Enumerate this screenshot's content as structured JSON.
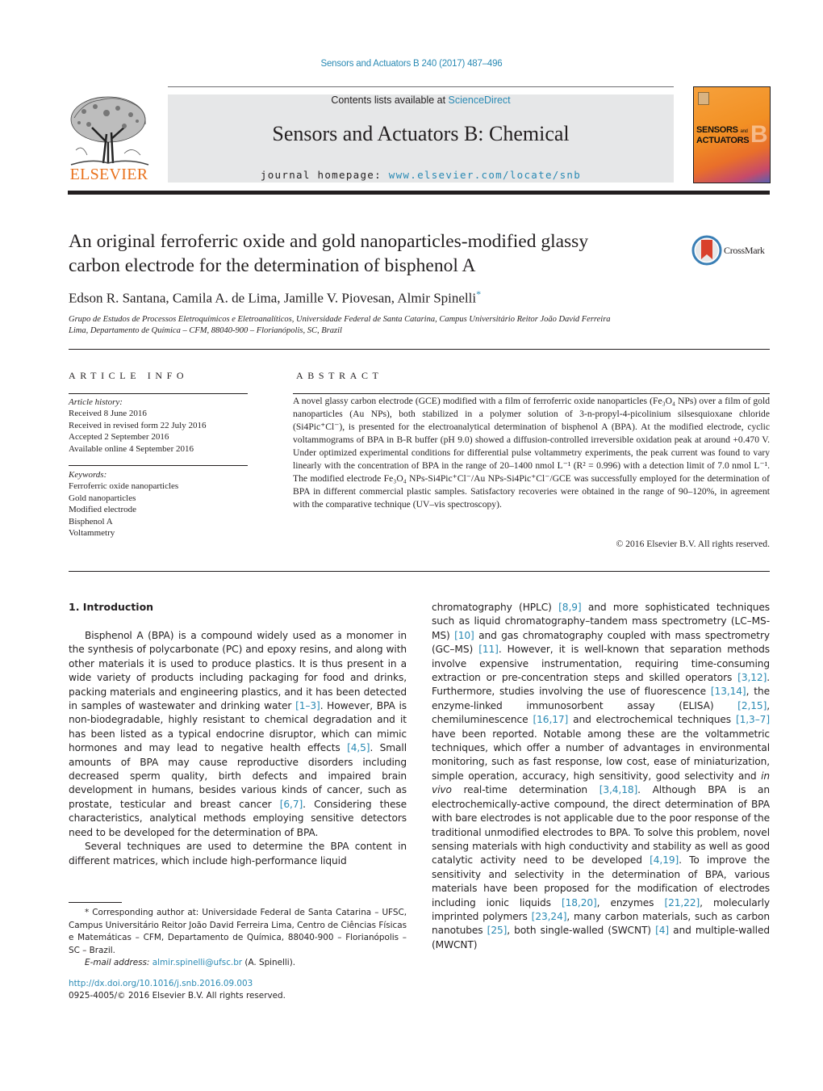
{
  "running_header": "Sensors and Actuators B 240 (2017) 487–496",
  "masthead": {
    "publisher_logo_word": "ELSEVIER",
    "contents_prefix": "Contents lists available at ",
    "contents_link": "ScienceDirect",
    "journal_title": "Sensors and Actuators B: Chemical",
    "homepage_prefix": "journal homepage: ",
    "homepage_link": "www.elsevier.com/locate/snb",
    "cover": {
      "line1": "SENSORS",
      "and": "and",
      "line2": "ACTUATORS",
      "letter": "B"
    }
  },
  "article": {
    "title_line1": "An original ferroferric oxide and gold nanoparticles-modified glassy",
    "title_line2": "carbon electrode for the determination of bisphenol A",
    "crossmark_label": "CrossMark",
    "authors": "Edson R. Santana, Camila A. de Lima, Jamille V. Piovesan, Almir Spinelli",
    "author_marker": "*",
    "affiliation_line1": "Grupo de Estudos de Processos Eletroquímicos e Eletroanalíticos, Universidade Federal de Santa Catarina, Campus Universitário Reitor João David Ferreira",
    "affiliation_line2": "Lima, Departamento de Química – CFM, 88040-900 – Florianópolis, SC, Brazil"
  },
  "article_info": {
    "heading": "ARTICLE INFO",
    "history_label": "Article history:",
    "history": [
      "Received 8 June 2016",
      "Received in revised form 22 July 2016",
      "Accepted 2 September 2016",
      "Available online 4 September 2016"
    ],
    "keywords_label": "Keywords:",
    "keywords": [
      "Ferroferric oxide nanoparticles",
      "Gold nanoparticles",
      "Modified electrode",
      "Bisphenol A",
      "Voltammetry"
    ]
  },
  "abstract": {
    "heading": "ABSTRACT",
    "text": "A novel glassy carbon electrode (GCE) modified with a film of ferroferric oxide nanoparticles (Fe₃O₄ NPs) over a film of gold nanoparticles (Au NPs), both stabilized in a polymer solution of 3-n-propyl-4-picolinium silsesquioxane chloride (Si4Pic⁺Cl⁻), is presented for the electroanalytical determination of bisphenol A (BPA). At the modified electrode, cyclic voltammograms of BPA in B-R buffer (pH 9.0) showed a diffusion-controlled irreversible oxidation peak at around +0.470 V. Under optimized experimental conditions for differential pulse voltammetry experiments, the peak current was found to vary linearly with the concentration of BPA in the range of 20–1400 nmol L⁻¹ (R² = 0.996) with a detection limit of 7.0 nmol L⁻¹. The modified electrode Fe₃O₄ NPs-Si4Pic⁺Cl⁻/Au NPs-Si4Pic⁺Cl⁻/GCE was successfully employed for the determination of BPA in different commercial plastic samples. Satisfactory recoveries were obtained in the range of 90–120%, in agreement with the comparative technique (UV–vis spectroscopy).",
    "copyright": "© 2016 Elsevier B.V. All rights reserved."
  },
  "body": {
    "section_heading": "1.  Introduction",
    "left_col": [
      {
        "segments": [
          {
            "t": "Bisphenol A (BPA) is a compound widely used as a monomer in the synthesis of polycarbonate (PC) and epoxy resins, and along with other materials it is used to produce plastics. It is thus present in a wide variety of products including packaging for food and drinks, packing materials and engineering plastics, and it has been detected in samples of wastewater and drinking water "
          },
          {
            "ref": "[1–3]"
          },
          {
            "t": ". However, BPA is non-biodegradable, highly resistant to chemical degradation and it has been listed as a typical endocrine disruptor, which can mimic hormones and may lead to negative health effects "
          },
          {
            "ref": "[4,5]"
          },
          {
            "t": ". Small amounts of BPA may cause reproductive disorders including decreased sperm quality, birth defects and impaired brain development in humans, besides various kinds of cancer, such as prostate, testicular and breast cancer "
          },
          {
            "ref": "[6,7]"
          },
          {
            "t": ". Considering these characteristics, analytical methods employing sensitive detectors need to be developed for the determination of BPA."
          }
        ]
      },
      {
        "segments": [
          {
            "t": "Several techniques are used to determine the BPA content in different matrices, which include high-performance liquid"
          }
        ]
      }
    ],
    "right_col": [
      {
        "segments": [
          {
            "t": "chromatography (HPLC) "
          },
          {
            "ref": "[8,9]"
          },
          {
            "t": " and more sophisticated techniques such as liquid chromatography–tandem mass spectrometry (LC–MS-MS) "
          },
          {
            "ref": "[10]"
          },
          {
            "t": " and gas chromatography coupled with mass spectrometry (GC–MS) "
          },
          {
            "ref": "[11]"
          },
          {
            "t": ". However, it is well-known that separation methods involve expensive instrumentation, requiring time-consuming extraction or pre-concentration steps and skilled operators "
          },
          {
            "ref": "[3,12]"
          },
          {
            "t": ". Furthermore, studies involving the use of fluorescence "
          },
          {
            "ref": "[13,14]"
          },
          {
            "t": ", the enzyme-linked immunosorbent assay (ELISA) "
          },
          {
            "ref": "[2,15]"
          },
          {
            "t": ", chemiluminescence "
          },
          {
            "ref": "[16,17]"
          },
          {
            "t": " and electrochemical techniques "
          },
          {
            "ref": "[1,3–7]"
          },
          {
            "t": " have been reported. Notable among these are the voltammetric techniques, which offer a number of advantages in environmental monitoring, such as fast response, low cost, ease of miniaturization, simple operation, accuracy, high sensitivity, good selectivity and "
          },
          {
            "i": "in vivo"
          },
          {
            "t": " real-time determination "
          },
          {
            "ref": "[3,4,18]"
          },
          {
            "t": ". Although BPA is an electrochemically-active compound, the direct determination of BPA with bare electrodes is not applicable due to the poor response of the traditional unmodified electrodes to BPA. To solve this problem, novel sensing materials with high conductivity and stability as well as good catalytic activity need to be developed "
          },
          {
            "ref": "[4,19]"
          },
          {
            "t": ". To improve the sensitivity and selectivity in the determination of BPA, various materials have been proposed for the modification of electrodes including ionic liquids "
          },
          {
            "ref": "[18,20]"
          },
          {
            "t": ", enzymes "
          },
          {
            "ref": "[21,22]"
          },
          {
            "t": ", molecularly imprinted polymers "
          },
          {
            "ref": "[23,24]"
          },
          {
            "t": ", many carbon materials, such as carbon nanotubes "
          },
          {
            "ref": "[25]"
          },
          {
            "t": ", both single-walled (SWCNT) "
          },
          {
            "ref": "[4]"
          },
          {
            "t": " and multiple-walled (MWCNT)"
          }
        ]
      }
    ]
  },
  "footnote": {
    "marker": "*",
    "text": " Corresponding author at: Universidade Federal de Santa Catarina – UFSC, Campus Universitário Reitor João David Ferreira Lima, Centro de Ciências Físicas e Matemáticas – CFM, Departamento de Química, 88040-900 – Florianópolis – SC – Brazil.",
    "email_label": "E-mail address: ",
    "email": "almir.spinelli@ufsc.br",
    "email_suffix": " (A. Spinelli).",
    "doi": "http://dx.doi.org/10.1016/j.snb.2016.09.003",
    "issn_line": "0925-4005/© 2016 Elsevier B.V. All rights reserved."
  }
}
